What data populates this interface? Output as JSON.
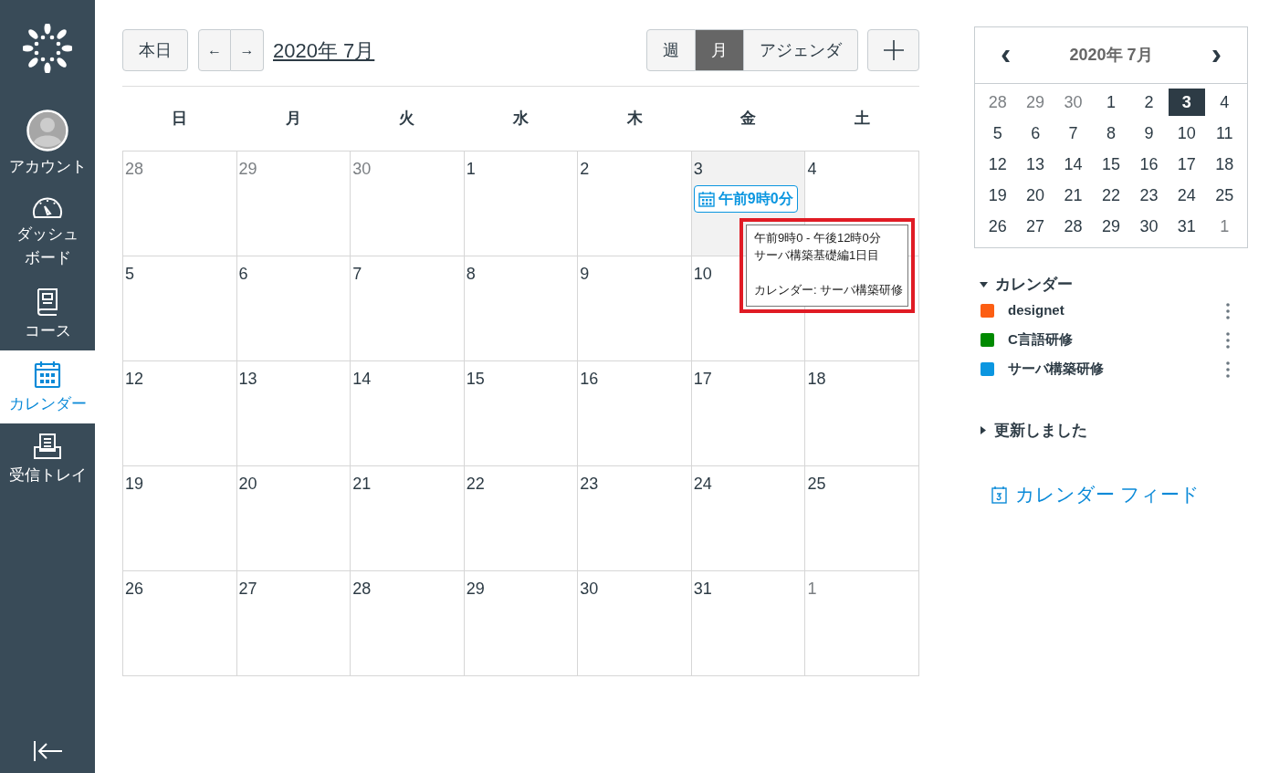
{
  "sidebar": {
    "items": [
      {
        "kind": "account",
        "label": "アカウント",
        "selected": false
      },
      {
        "kind": "dashboard",
        "label": "ダッシュボード",
        "selected": false
      },
      {
        "kind": "courses",
        "label": "コース",
        "selected": false
      },
      {
        "kind": "calendar",
        "label": "カレンダー",
        "selected": true
      },
      {
        "kind": "inbox",
        "label": "受信トレイ",
        "selected": false
      }
    ]
  },
  "toolbar": {
    "today": "本日",
    "prev": "←",
    "next": "→",
    "title": "2020年 7月",
    "views": [
      {
        "label": "週",
        "selected": false
      },
      {
        "label": "月",
        "selected": true
      },
      {
        "label": "アジェンダ",
        "selected": false
      }
    ]
  },
  "weekdays": [
    "日",
    "月",
    "火",
    "水",
    "木",
    "金",
    "土"
  ],
  "weeks": [
    [
      {
        "day": "28",
        "other_month": true,
        "today": false
      },
      {
        "day": "29",
        "other_month": true,
        "today": false
      },
      {
        "day": "30",
        "other_month": true,
        "today": false
      },
      {
        "day": "1",
        "other_month": false,
        "today": false
      },
      {
        "day": "2",
        "other_month": false,
        "today": false
      },
      {
        "day": "3",
        "other_month": false,
        "today": true,
        "events": [
          {
            "label": "午前9時0分",
            "color": "#0b96e0"
          }
        ]
      },
      {
        "day": "4",
        "other_month": false,
        "today": false
      }
    ],
    [
      {
        "day": "5",
        "other_month": false,
        "today": false
      },
      {
        "day": "6",
        "other_month": false,
        "today": false
      },
      {
        "day": "7",
        "other_month": false,
        "today": false
      },
      {
        "day": "8",
        "other_month": false,
        "today": false
      },
      {
        "day": "9",
        "other_month": false,
        "today": false
      },
      {
        "day": "10",
        "other_month": false,
        "today": false
      },
      {
        "today": false
      }
    ],
    [
      {
        "day": "12",
        "other_month": false,
        "today": false
      },
      {
        "day": "13",
        "other_month": false,
        "today": false
      },
      {
        "day": "14",
        "other_month": false,
        "today": false
      },
      {
        "day": "15",
        "other_month": false,
        "today": false
      },
      {
        "day": "16",
        "other_month": false,
        "today": false
      },
      {
        "day": "17",
        "other_month": false,
        "today": false
      },
      {
        "day": "18",
        "other_month": false,
        "today": false
      }
    ],
    [
      {
        "day": "19",
        "other_month": false,
        "today": false
      },
      {
        "day": "20",
        "other_month": false,
        "today": false
      },
      {
        "day": "21",
        "other_month": false,
        "today": false
      },
      {
        "day": "22",
        "other_month": false,
        "today": false
      },
      {
        "day": "23",
        "other_month": false,
        "today": false
      },
      {
        "day": "24",
        "other_month": false,
        "today": false
      },
      {
        "day": "25",
        "other_month": false,
        "today": false
      }
    ],
    [
      {
        "day": "26",
        "other_month": false,
        "today": false
      },
      {
        "day": "27",
        "other_month": false,
        "today": false
      },
      {
        "day": "28",
        "other_month": false,
        "today": false
      },
      {
        "day": "29",
        "other_month": false,
        "today": false
      },
      {
        "day": "30",
        "other_month": false,
        "today": false
      },
      {
        "day": "31",
        "other_month": false,
        "today": false
      },
      {
        "day": "1",
        "other_month": true,
        "today": false
      }
    ]
  ],
  "tooltip": {
    "time": "午前9時0 - 午後12時0分",
    "title": "サーバ構築基礎編1日目",
    "calendar": "カレンダー: サーバ構築研修"
  },
  "mini_calendar": {
    "prev": "‹",
    "title": "2020年 7月",
    "next": "›",
    "weeks": [
      [
        {
          "day": "28",
          "other_month": true,
          "selected": false
        },
        {
          "day": "29",
          "other_month": true,
          "selected": false
        },
        {
          "day": "30",
          "other_month": true,
          "selected": false
        },
        {
          "day": "1",
          "other_month": false,
          "selected": false
        },
        {
          "day": "2",
          "other_month": false,
          "selected": false
        },
        {
          "day": "3",
          "other_month": false,
          "selected": true
        },
        {
          "day": "4",
          "other_month": false,
          "selected": false
        }
      ],
      [
        {
          "day": "5",
          "other_month": false,
          "selected": false
        },
        {
          "day": "6",
          "other_month": false,
          "selected": false
        },
        {
          "day": "7",
          "other_month": false,
          "selected": false
        },
        {
          "day": "8",
          "other_month": false,
          "selected": false
        },
        {
          "day": "9",
          "other_month": false,
          "selected": false
        },
        {
          "day": "10",
          "other_month": false,
          "selected": false
        },
        {
          "day": "11",
          "other_month": false,
          "selected": false
        }
      ],
      [
        {
          "day": "12",
          "other_month": false,
          "selected": false
        },
        {
          "day": "13",
          "other_month": false,
          "selected": false
        },
        {
          "day": "14",
          "other_month": false,
          "selected": false
        },
        {
          "day": "15",
          "other_month": false,
          "selected": false
        },
        {
          "day": "16",
          "other_month": false,
          "selected": false
        },
        {
          "day": "17",
          "other_month": false,
          "selected": false
        },
        {
          "day": "18",
          "other_month": false,
          "selected": false
        }
      ],
      [
        {
          "day": "19",
          "other_month": false,
          "selected": false
        },
        {
          "day": "20",
          "other_month": false,
          "selected": false
        },
        {
          "day": "21",
          "other_month": false,
          "selected": false
        },
        {
          "day": "22",
          "other_month": false,
          "selected": false
        },
        {
          "day": "23",
          "other_month": false,
          "selected": false
        },
        {
          "day": "24",
          "other_month": false,
          "selected": false
        },
        {
          "day": "25",
          "other_month": false,
          "selected": false
        }
      ],
      [
        {
          "day": "26",
          "other_month": false,
          "selected": false
        },
        {
          "day": "27",
          "other_month": false,
          "selected": false
        },
        {
          "day": "28",
          "other_month": false,
          "selected": false
        },
        {
          "day": "29",
          "other_month": false,
          "selected": false
        },
        {
          "day": "30",
          "other_month": false,
          "selected": false
        },
        {
          "day": "31",
          "other_month": false,
          "selected": false
        },
        {
          "day": "1",
          "other_month": true,
          "selected": false
        }
      ]
    ]
  },
  "calendars": {
    "title": "カレンダー",
    "expanded": true,
    "items": [
      {
        "name": "designet",
        "color": "#fc5e13"
      },
      {
        "name": "C言語研修",
        "color": "#008a00"
      },
      {
        "name": "サーバ構築研修",
        "color": "#0b96e0"
      }
    ]
  },
  "undated": {
    "title": "更新しました",
    "expanded": false
  },
  "feed_link": "カレンダー フィード"
}
